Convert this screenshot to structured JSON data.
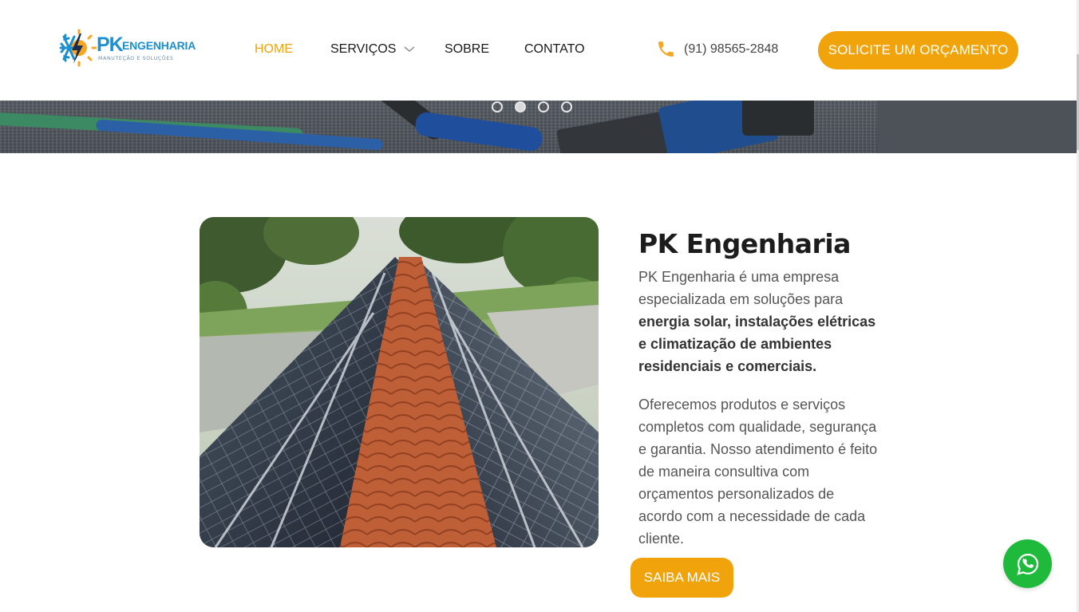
{
  "colors": {
    "accent": "#f0a30a",
    "brand_blue": "#1b8fd0",
    "whatsapp_green": "#1fba3c",
    "text_dark": "#1c1c1c",
    "text_body": "#555555"
  },
  "header": {
    "logo": {
      "pk": "PK",
      "name": "ENGENHARIA",
      "tagline": "MANUTEÇÃO E SOLUÇÕES",
      "icon": "snowflake-bolt-sun-logo-icon"
    },
    "nav": [
      {
        "label": "HOME",
        "active": true
      },
      {
        "label": "SERVIÇOS",
        "active": false,
        "has_dropdown": true
      },
      {
        "label": "SOBRE",
        "active": false
      },
      {
        "label": "CONTATO",
        "active": false
      }
    ],
    "phone": {
      "icon": "phone-icon",
      "number": "(91) 98565-2848"
    },
    "cta_label": "SOLICITE UM ORÇAMENTO"
  },
  "hero": {
    "slide_count": 4,
    "active_slide": 2
  },
  "about": {
    "title": "PK Engenharia",
    "p1_intro": "PK Engenharia é uma empresa especializada em soluções para ",
    "p1_strong": "energia solar, instalações elétricas e climatização de ambientes residenciais e comerciais.",
    "p2": "Oferecemos produtos e serviços completos com qualidade, segurança e garantia. Nosso atendimento é feito de maneira consultiva com orçamentos personalizados de acordo com a necessidade de cada cliente.",
    "button_label": "SAIBA MAIS"
  },
  "whatsapp": {
    "icon": "whatsapp-icon"
  }
}
